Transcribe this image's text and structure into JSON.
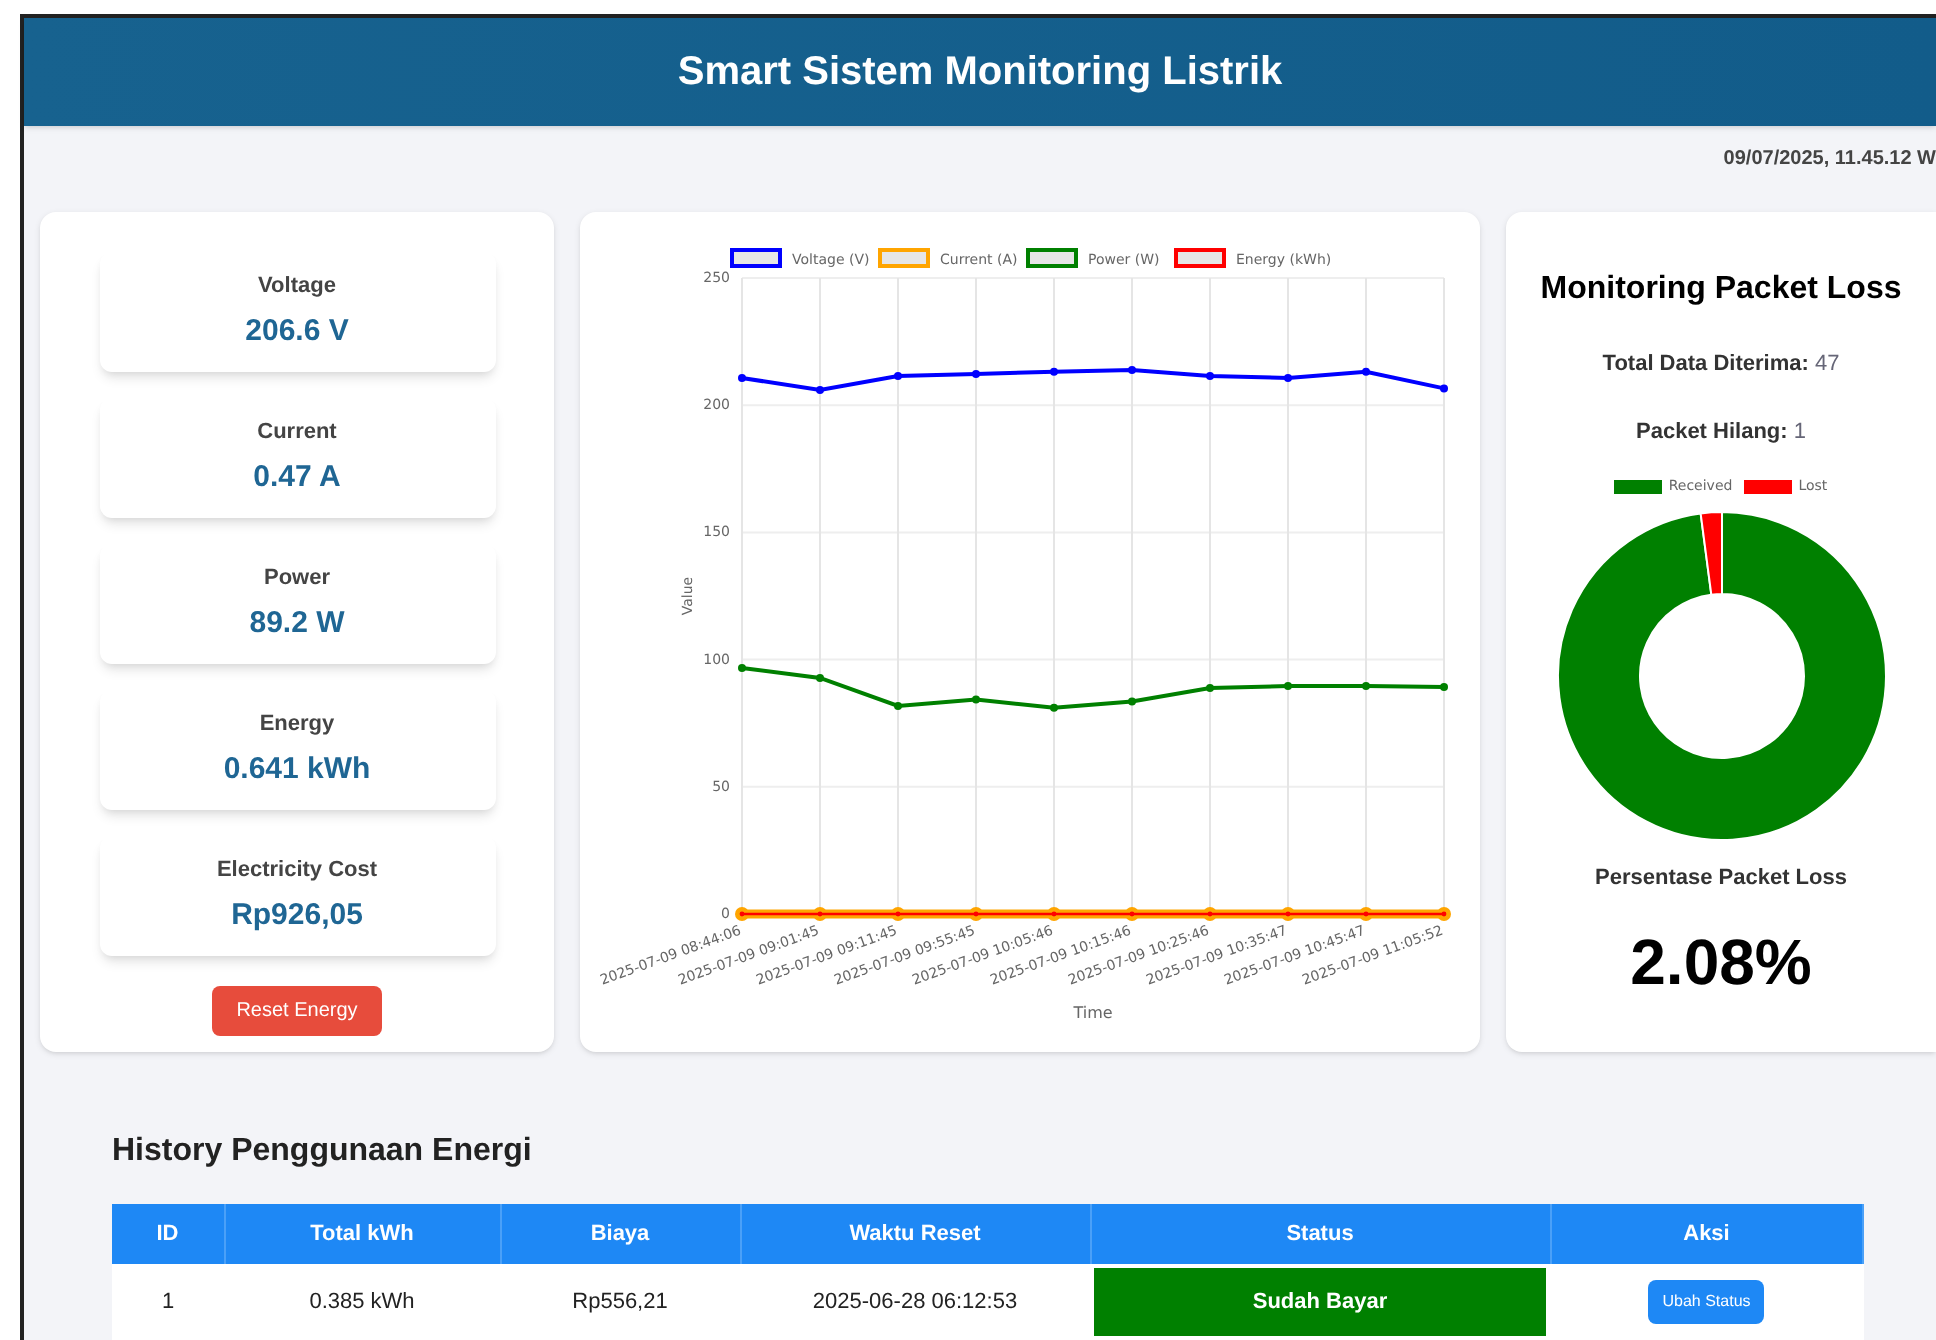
{
  "header": {
    "title": "Smart Sistem Monitoring Listrik"
  },
  "timestamp": "09/07/2025, 11.45.12 W",
  "metrics": [
    {
      "label": "Voltage",
      "value": "206.6 V"
    },
    {
      "label": "Current",
      "value": "0.47 A"
    },
    {
      "label": "Power",
      "value": "89.2 W"
    },
    {
      "label": "Energy",
      "value": "0.641 kWh"
    },
    {
      "label": "Electricity Cost",
      "value": "Rp926,05"
    }
  ],
  "reset_button": "Reset Energy",
  "chart": {
    "chart_data": {
      "type": "line",
      "xlabel": "Time",
      "ylabel": "Value",
      "categories": [
        "2025-07-09 08:44:06",
        "2025-07-09 09:01:45",
        "2025-07-09 09:11:45",
        "2025-07-09 09:55:45",
        "2025-07-09 10:05:46",
        "2025-07-09 10:15:46",
        "2025-07-09 10:25:46",
        "2025-07-09 10:35:47",
        "2025-07-09 10:45:47",
        "2025-07-09 11:05:52"
      ],
      "series": [
        {
          "name": "Voltage (V)",
          "color": "#0000ff",
          "marker": true,
          "values": [
            210.7,
            206.0,
            211.5,
            212.3,
            213.1,
            213.8,
            211.5,
            210.7,
            213.1,
            206.6
          ]
        },
        {
          "name": "Current (A)",
          "color": "#ffa500",
          "marker": true,
          "values": [
            0,
            0,
            0,
            0,
            0,
            0,
            0,
            0,
            0,
            0
          ]
        },
        {
          "name": "Power (W)",
          "color": "#008000",
          "marker": true,
          "values": [
            96.7,
            92.8,
            81.8,
            84.3,
            81.1,
            83.5,
            88.8,
            89.6,
            89.6,
            89.2
          ]
        },
        {
          "name": "Energy (kWh)",
          "color": "#ff0000",
          "marker": true,
          "values": [
            0,
            0,
            0,
            0,
            0,
            0,
            0,
            0,
            0,
            0
          ]
        }
      ],
      "ylim": [
        0,
        250
      ],
      "yticks": [
        0,
        50,
        100,
        150,
        200,
        250
      ],
      "grid": true,
      "legend": "top"
    }
  },
  "packet_loss": {
    "title": "Monitoring Packet Loss",
    "received_label": "Total Data Diterima:",
    "received_value": "47",
    "lost_label": "Packet Hilang:",
    "lost_value": "1",
    "chart_data": {
      "type": "donut",
      "categories": [
        "Received",
        "Lost"
      ],
      "series": [
        {
          "values": [
            97.92,
            2.08
          ]
        }
      ],
      "colors": [
        "#008000",
        "#ff0000"
      ]
    },
    "percent_label": "Persentase Packet Loss",
    "percent_value": "2.08%"
  },
  "history": {
    "title": "History Penggunaan Energi",
    "columns": [
      "ID",
      "Total kWh",
      "Biaya",
      "Waktu Reset",
      "Status",
      "Aksi"
    ],
    "rows": [
      {
        "id": "1",
        "kwh": "0.385 kWh",
        "cost": "Rp556,21",
        "time": "2025-06-28 06:12:53",
        "status": "Sudah Bayar",
        "paid": true,
        "action": "Ubah Status"
      }
    ]
  }
}
